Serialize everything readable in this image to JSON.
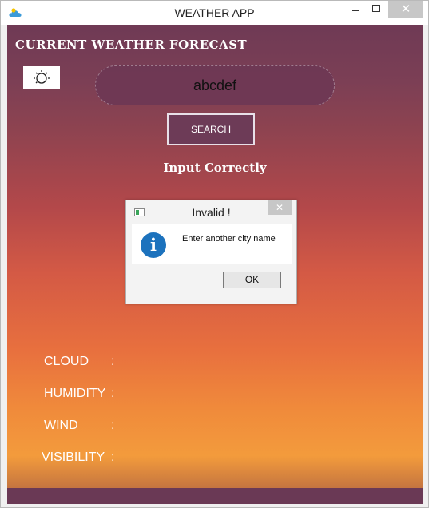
{
  "window": {
    "title": "WEATHER APP",
    "close_glyph": "✕"
  },
  "main": {
    "heading": "CURRENT WEATHER FORECAST",
    "weather_icon": "partly-cloudy-sun-icon",
    "search_value": "abcdef",
    "search_button": "SEARCH",
    "status_text": "Input Correctly"
  },
  "details": [
    {
      "label": "CLOUD",
      "colon": ":"
    },
    {
      "label": "HUMIDITY",
      "colon": ":"
    },
    {
      "label": "WIND",
      "colon": ":"
    },
    {
      "label": "VISIBILITY",
      "colon": ":"
    }
  ],
  "dialog": {
    "title": "Invalid !",
    "close_glyph": "✕",
    "icon": "info-icon",
    "icon_glyph": "i",
    "message": "Enter another city name",
    "ok_label": "OK"
  },
  "colors": {
    "background_top": "#6f3a55",
    "background_bottom": "#f39b3c",
    "button_bg": "#6d3b57",
    "info_blue": "#1c72bd"
  }
}
